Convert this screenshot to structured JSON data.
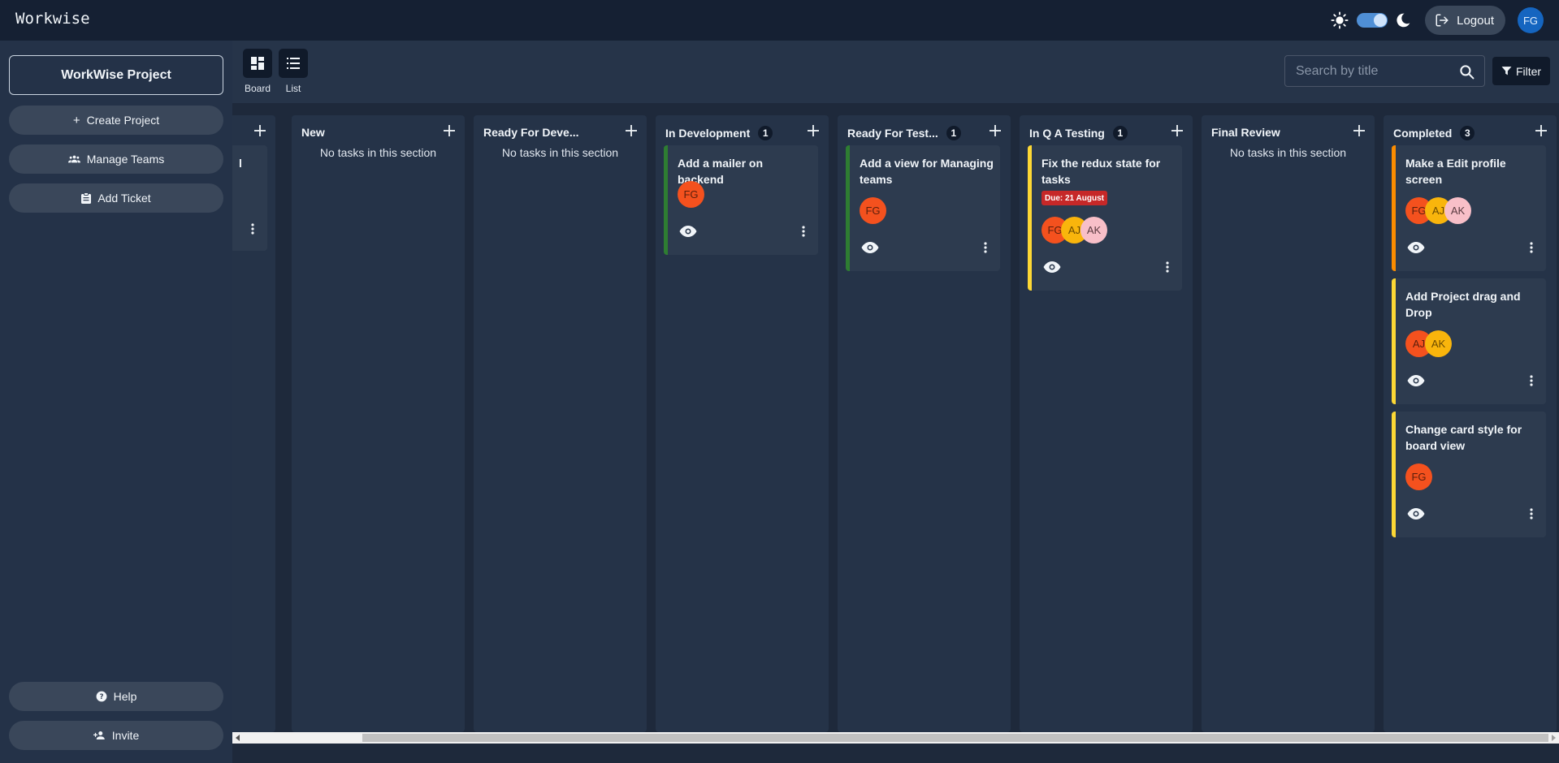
{
  "app": {
    "title": "Workwise"
  },
  "header": {
    "logout_label": "Logout",
    "user_initials": "FG"
  },
  "sidebar": {
    "project_title": "WorkWise Project",
    "buttons": [
      {
        "label": "Create Project",
        "icon": "plus-icon"
      },
      {
        "label": "Manage Teams",
        "icon": "teams-icon"
      },
      {
        "label": "Add Ticket",
        "icon": "clipboard-icon"
      }
    ],
    "bottom_buttons": [
      {
        "label": "Help",
        "icon": "help-icon"
      },
      {
        "label": "Invite",
        "icon": "person-add-icon"
      }
    ]
  },
  "toolbar": {
    "views": [
      {
        "label": "Board",
        "icon": "board-icon"
      },
      {
        "label": "List",
        "icon": "list-icon"
      }
    ],
    "search_placeholder": "Search by title",
    "filter_label": "Filter"
  },
  "board": {
    "partial_column": {
      "card_fragment": "l"
    },
    "columns": [
      {
        "title": "New",
        "count": "",
        "empty_text": "No tasks in this section",
        "cards": []
      },
      {
        "title": "Ready For Deve...",
        "count": "",
        "empty_text": "No tasks in this section",
        "cards": []
      },
      {
        "title": "In Development",
        "count": "1",
        "cards": [
          {
            "title": "Add a mailer on backend",
            "assignees": [
              "FG"
            ]
          }
        ]
      },
      {
        "title": "Ready For Test...",
        "count": "1",
        "cards": [
          {
            "title": "Add a view for Managing teams",
            "assignees": [
              "FG"
            ]
          }
        ]
      },
      {
        "title": "In Q A Testing",
        "count": "1",
        "cards": [
          {
            "title": "Fix the redux state for tasks",
            "due": "Due: 21 August",
            "assignees": [
              "FG",
              "AJ",
              "AK"
            ]
          }
        ]
      },
      {
        "title": "Final Review",
        "count": "",
        "empty_text": "No tasks in this section",
        "cards": []
      },
      {
        "title": "Completed",
        "count": "3",
        "cards": [
          {
            "title": "Make a Edit profile screen",
            "assignees": [
              "FG",
              "AJ",
              "AK"
            ]
          },
          {
            "title": "Add Project drag and Drop",
            "assignees": [
              "AJ",
              "AK"
            ]
          },
          {
            "title": "Change card style for board view",
            "assignees": [
              "FG"
            ]
          }
        ]
      }
    ]
  },
  "colors": {
    "priority_green": "#2e7d32",
    "priority_yellow": "#fdd835",
    "priority_orange": "#fb8c00",
    "due_red": "#c62828",
    "accent_blue": "#1565c0"
  }
}
